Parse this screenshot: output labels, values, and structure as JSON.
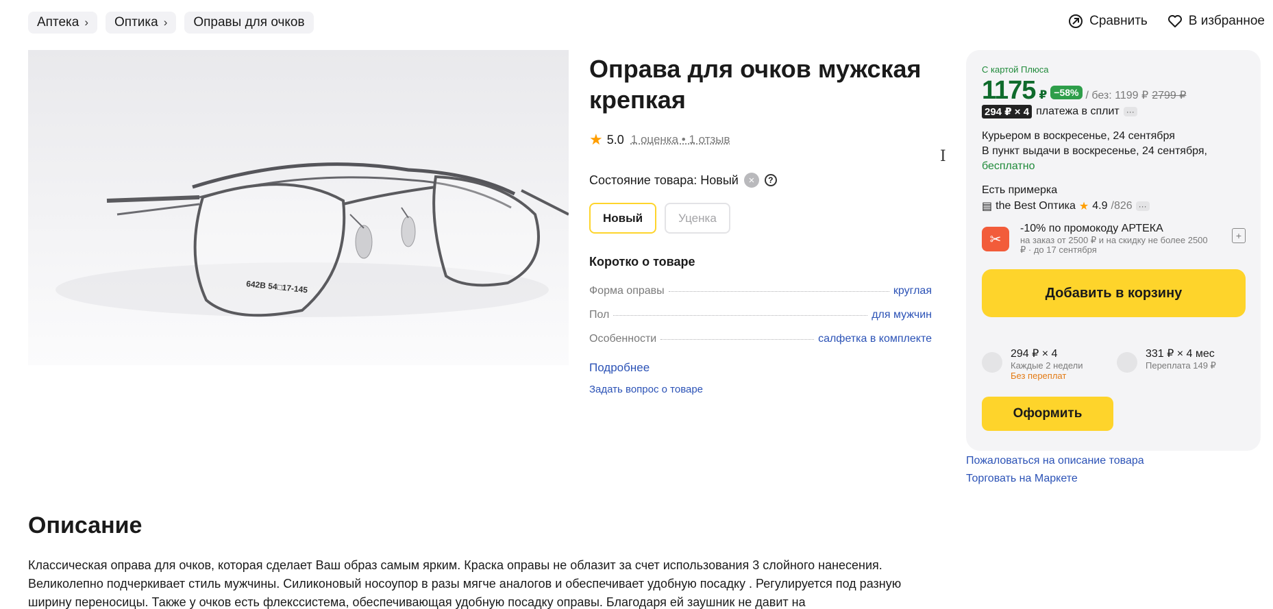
{
  "breadcrumbs": [
    "Аптека",
    "Оптика",
    "Оправы для очков"
  ],
  "top_actions": {
    "compare": "Сравнить",
    "favorite": "В избранное"
  },
  "product": {
    "title": "Оправа для очков мужская крепкая",
    "rating": "5.0",
    "reviews": "1 оценка • 1 отзыв",
    "condition_label": "Состояние товара: Новый",
    "condition_options": [
      {
        "label": "Новый",
        "selected": true
      },
      {
        "label": "Уценка",
        "selected": false
      }
    ],
    "image_marking": "642B 54□17-145"
  },
  "about": {
    "heading": "Коротко о товаре",
    "specs": [
      {
        "key": "Форма оправы",
        "value": "круглая"
      },
      {
        "key": "Пол",
        "value": "для мужчин"
      },
      {
        "key": "Особенности",
        "value": "салфетка в комплекте"
      }
    ],
    "more": "Подробнее",
    "ask": "Задать вопрос о товаре"
  },
  "offer": {
    "plus_label": "С картой Плюса",
    "price": "1175",
    "currency": "₽",
    "discount": "−58%",
    "without_card": "/ без: 1199 ₽",
    "old_price": "2799 ₽",
    "split_badge": "294 ₽ × 4",
    "split_text": "платежа в сплит",
    "more_dots": "···",
    "delivery_courier": "Курьером в воскресенье, 24 сентября",
    "delivery_pickup": "В пункт выдачи в воскресенье, 24 сентября,",
    "delivery_free": "бесплатно",
    "fitting": "Есть примерка",
    "seller_name": "the Best Оптика",
    "seller_rating": "4.9",
    "seller_count": "/826",
    "promo_title": "-10% по промокоду АРТЕКА",
    "promo_sub": "на заказ от 2500 ₽ и на скидку не более 2500 ₽ · до 17 сентября",
    "add_to_cart": "Добавить в корзину",
    "installments": [
      {
        "title": "294 ₽ × 4",
        "sub": "Каждые 2 недели",
        "extra": "Без переплат"
      },
      {
        "title": "331 ₽ × 4 мес",
        "sub": "Переплата 149 ₽",
        "extra": ""
      }
    ],
    "checkout": "Оформить"
  },
  "side_links": [
    "Пожаловаться на описание товара",
    "Торговать на Маркете"
  ],
  "description": {
    "heading": "Описание",
    "text": "Классическая оправа для очков, которая сделает Ваш образ самым ярким. Краска оправы не облазит за счет использования 3 слойного нанесения. Великолепно подчеркивает стиль мужчины. Силиконовый носоупор в разы мягче аналогов и обеспечивает удобную посадку . Регулируется под разную ширину переносицы. Также у очков есть флекссистема, обеспечивающая удобную посадку оправы. Благодаря ей заушник не давит на"
  },
  "colors": {
    "accent_yellow": "#fed42b",
    "price_green": "#0f6b2c",
    "link_blue": "#2b52b6",
    "promo_orange": "#f25c3a"
  }
}
